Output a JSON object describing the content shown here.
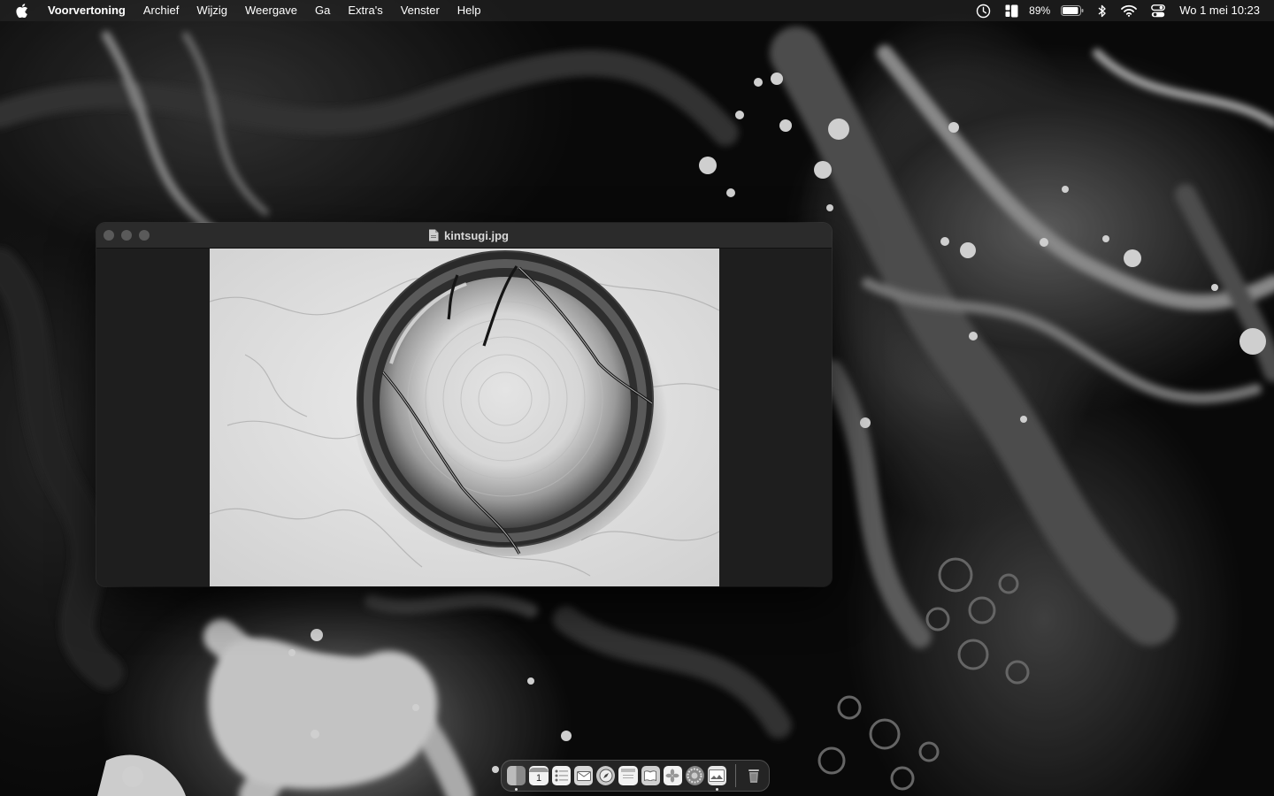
{
  "menubar": {
    "app_name": "Voorvertoning",
    "menus": [
      "Archief",
      "Wijzig",
      "Weergave",
      "Ga",
      "Extra's",
      "Venster",
      "Help"
    ],
    "battery_percent": "89%",
    "datetime": "Wo 1 mei  10:23",
    "status_icons": [
      "time-machine-icon",
      "stage-manager-icon",
      "battery-icon",
      "bluetooth-icon",
      "wifi-icon",
      "control-center-icon"
    ]
  },
  "window": {
    "title": "kintsugi.jpg",
    "image_subject": "kintsugi bowl on marble"
  },
  "dock": {
    "apps": [
      "Finder",
      "Calendar",
      "Reminders",
      "Mail",
      "Safari",
      "Notes",
      "Books",
      "Photos",
      "System Settings",
      "Preview",
      "Trash"
    ],
    "calendar_day": "1"
  },
  "colors": {
    "menubar_bg": "#282828",
    "window_bg": "#1e1e1e",
    "titlebar_bg": "#2b2b2b",
    "traffic_light": "#5a5a5a"
  }
}
